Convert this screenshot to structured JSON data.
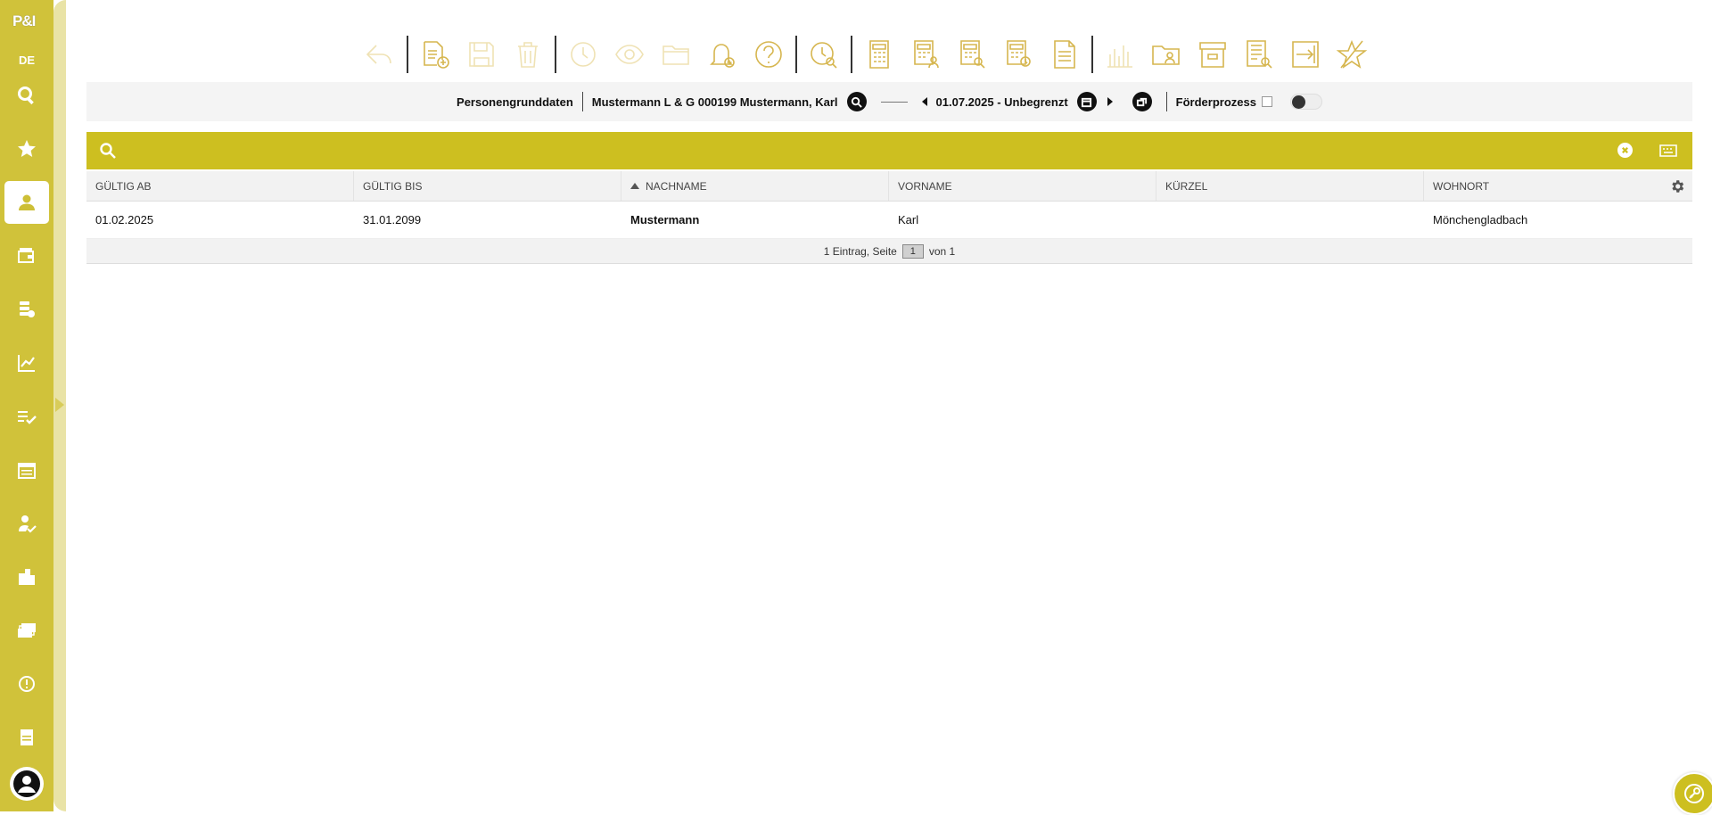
{
  "app": {
    "logo_text": "P&I",
    "language": "DE"
  },
  "colors": {
    "accent": "#d0c23a",
    "searchbar": "#cdbf20",
    "toolbar_icon": "#d6b64f",
    "toolbar_icon_disabled": "#efe2b4"
  },
  "sidebar": {
    "items": [
      {
        "icon": "search-icon",
        "active": false
      },
      {
        "icon": "star-icon",
        "active": false
      },
      {
        "icon": "person-icon",
        "active": true
      },
      {
        "icon": "wallet-icon",
        "active": false
      },
      {
        "icon": "coins-icon",
        "active": false
      },
      {
        "icon": "chart-icon",
        "active": false
      },
      {
        "icon": "checklist-icon",
        "active": false
      },
      {
        "icon": "calendar-icon",
        "active": false
      },
      {
        "icon": "person-check-icon",
        "active": false
      },
      {
        "icon": "buildings-icon",
        "active": false
      },
      {
        "icon": "money-icon",
        "active": false
      },
      {
        "icon": "alert-icon",
        "active": false
      },
      {
        "icon": "document-icon",
        "active": false
      }
    ],
    "user_icon": "user-avatar-icon"
  },
  "toolbar": {
    "icons": [
      {
        "icon": "undo-icon",
        "disabled": true
      },
      {
        "icon": "new-document-icon",
        "disabled": false
      },
      {
        "icon": "save-icon",
        "disabled": true
      },
      {
        "icon": "trash-icon",
        "disabled": true
      },
      {
        "icon": "history-icon",
        "disabled": true
      },
      {
        "icon": "eye-icon",
        "disabled": true
      },
      {
        "icon": "folder-icon",
        "disabled": true
      },
      {
        "icon": "bell-add-icon",
        "disabled": false
      },
      {
        "icon": "help-icon",
        "disabled": false
      },
      {
        "icon": "clock-search-icon",
        "disabled": false
      },
      {
        "icon": "calculator-icon",
        "disabled": false
      },
      {
        "icon": "calculator-person-icon",
        "disabled": false
      },
      {
        "icon": "calculator-search-icon",
        "disabled": false
      },
      {
        "icon": "calculator-clock-icon",
        "disabled": false
      },
      {
        "icon": "text-document-icon",
        "disabled": false
      },
      {
        "icon": "bar-chart-icon",
        "disabled": true
      },
      {
        "icon": "folder-person-icon",
        "disabled": false
      },
      {
        "icon": "archive-icon",
        "disabled": false
      },
      {
        "icon": "list-search-icon",
        "disabled": false
      },
      {
        "icon": "export-icon",
        "disabled": false
      },
      {
        "icon": "star-outline-icon",
        "disabled": false
      }
    ]
  },
  "context": {
    "module": "Personengrunddaten",
    "person": "Mustermann L & G 000199 Mustermann, Karl",
    "period": "01.07.2025 - Unbegrenzt",
    "process_label": "Förderprozess"
  },
  "search": {
    "value": "",
    "placeholder": ""
  },
  "table": {
    "columns": [
      "GÜLTIG AB",
      "GÜLTIG BIS",
      "NACHNAME",
      "VORNAME",
      "KÜRZEL",
      "WOHNORT"
    ],
    "sorted_column": 2,
    "rows": [
      [
        "01.02.2025",
        "31.01.2099",
        "Mustermann",
        "Karl",
        "",
        "Mönchengladbach"
      ]
    ]
  },
  "pager": {
    "prefix": "1 Eintrag, Seite",
    "current": "1",
    "suffix": "von 1"
  }
}
